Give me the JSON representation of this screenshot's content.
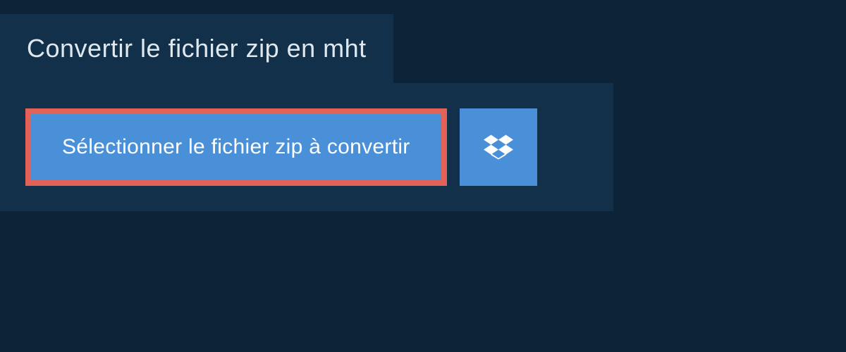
{
  "header": {
    "title": "Convertir le fichier zip en mht"
  },
  "actions": {
    "select_file_label": "Sélectionner le fichier zip à convertir"
  },
  "colors": {
    "background": "#0d2438",
    "panel": "#12304a",
    "button_bg": "#4a90d9",
    "highlight_border": "#e26257",
    "text_light": "#dfe8ef"
  }
}
